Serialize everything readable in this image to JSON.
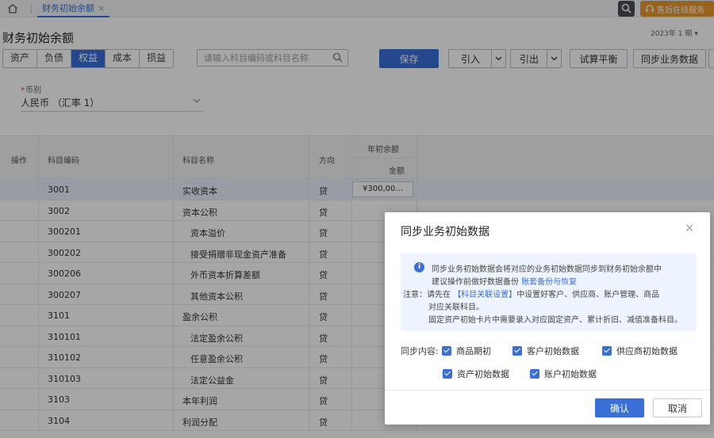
{
  "topbar": {
    "tab_label": "财务初始余额",
    "tab_close": "×",
    "service_label": "售后在线服务"
  },
  "page": {
    "title": "财务初始余额",
    "period": "2023年 1 期",
    "period_caret": "▾"
  },
  "type_tabs": [
    {
      "label": "资产"
    },
    {
      "label": "负债"
    },
    {
      "label": "权益",
      "active": true
    },
    {
      "label": "成本"
    },
    {
      "label": "损益"
    }
  ],
  "search": {
    "placeholder": "请输入科目编码或科目名称"
  },
  "toolbar": {
    "save": "保存",
    "import": "引入",
    "export": "引出",
    "trial_balance": "试算平衡",
    "sync": "同步业务数据"
  },
  "currency": {
    "label": "币别",
    "required_mark": "*",
    "value": "人民币 （汇率 1）"
  },
  "table": {
    "headers": {
      "op": "操作",
      "code": "科目编码",
      "name": "科目名称",
      "direction": "方向",
      "year_init": "年初余额",
      "amount": "金额"
    },
    "rows": [
      {
        "code": "3001",
        "name": "实收资本",
        "dir": "贷",
        "amount": "¥300,00...",
        "indent": false,
        "selected": true
      },
      {
        "code": "3002",
        "name": "资本公积",
        "dir": "贷",
        "amount": "",
        "indent": false
      },
      {
        "code": "300201",
        "name": "资本溢价",
        "dir": "贷",
        "amount": "",
        "indent": true
      },
      {
        "code": "300202",
        "name": "接受捐赠非现金资产准备",
        "dir": "贷",
        "amount": "",
        "indent": true
      },
      {
        "code": "300206",
        "name": "外币资本折算差额",
        "dir": "贷",
        "amount": "",
        "indent": true
      },
      {
        "code": "300207",
        "name": "其他资本公积",
        "dir": "贷",
        "amount": "",
        "indent": true
      },
      {
        "code": "3101",
        "name": "盈余公积",
        "dir": "贷",
        "amount": "",
        "indent": false
      },
      {
        "code": "310101",
        "name": "法定盈余公积",
        "dir": "贷",
        "amount": "",
        "indent": true
      },
      {
        "code": "310102",
        "name": "任意盈余公积",
        "dir": "贷",
        "amount": "",
        "indent": true
      },
      {
        "code": "310103",
        "name": "法定公益金",
        "dir": "贷",
        "amount": "",
        "indent": true
      },
      {
        "code": "3103",
        "name": "本年利润",
        "dir": "贷",
        "amount": "",
        "indent": false
      },
      {
        "code": "3104",
        "name": "利润分配",
        "dir": "贷",
        "amount": "",
        "indent": false
      }
    ]
  },
  "modal": {
    "title": "同步业务初始数据",
    "close": "×",
    "info_icon": "i",
    "info_line1": "同步业务初始数据会将对应的业务初始数据同步到财务初始余额中",
    "info_line2_prefix": "建议操作前做好数据备份",
    "info_line2_link": "账套备份与恢复",
    "note_label": "注意：",
    "note_line1_prefix": "请先在",
    "note_line1_link": "【科目关联设置】",
    "note_line1_suffix": "中设置好客户、供应商、账户管理、商品",
    "note_line2": "对应关联科目。",
    "note_line3": "固定资产初始卡片中需要录入对应固定资产、累计折旧、减值准备科目。",
    "sync_label": "同步内容:",
    "options": [
      {
        "label": "商品期初",
        "checked": true
      },
      {
        "label": "客户初始数据",
        "checked": true
      },
      {
        "label": "供应商初始数据",
        "checked": true
      },
      {
        "label": "资产初始数据",
        "checked": true
      },
      {
        "label": "账户初始数据",
        "checked": true
      }
    ],
    "confirm": "确认",
    "cancel": "取消"
  },
  "colors": {
    "accent": "#3a6fd8",
    "service": "#e79a2b",
    "overlay": "rgba(0,0,0,0.35)"
  }
}
